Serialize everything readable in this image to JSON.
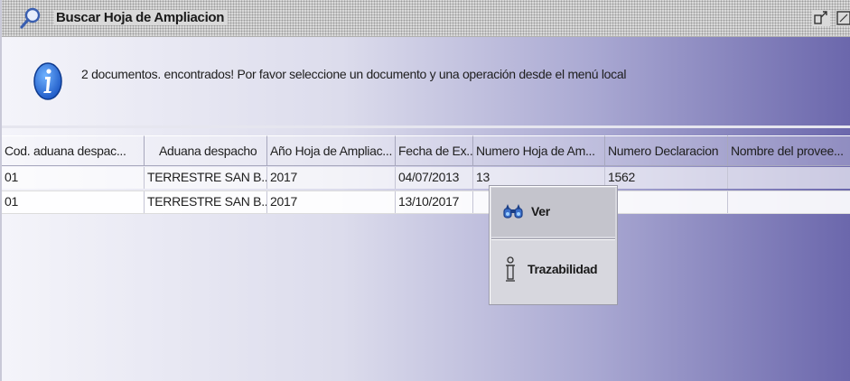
{
  "window": {
    "title": "Buscar Hoja de Ampliacion",
    "title_icon": "search-magnifier-icon",
    "controls": [
      "undock-icon",
      "maximize-icon"
    ]
  },
  "message": {
    "icon": "info-icon",
    "text": "2 documentos. encontrados! Por favor seleccione un documento y una operación desde el menú local"
  },
  "table": {
    "columns": [
      "Cod. aduana despac...",
      "Aduana despacho",
      "Año Hoja de Ampliac...",
      "Fecha de Ex...",
      "Numero Hoja de Am...",
      "Numero Declaracion",
      "Nombre del provee..."
    ],
    "rows": [
      [
        "01",
        "TERRESTRE SAN B...",
        "2017",
        "04/07/2013",
        "13",
        "1562",
        ""
      ],
      [
        "01",
        "TERRESTRE SAN B...",
        "2017",
        "13/10/2017",
        "",
        "",
        ""
      ]
    ]
  },
  "context_menu": {
    "items": [
      {
        "label": "Ver",
        "icon": "binoculars-icon"
      },
      {
        "label": "Trazabilidad",
        "icon": "trace-icon"
      }
    ]
  },
  "colors": {
    "background_light": "#f4f4fa",
    "background_dark": "#6b67ac",
    "titlebar": "#d9d9d9",
    "info_blue": "#1a6fd1",
    "menu_bg": "#d7d7de",
    "menu_highlight": "#c4c4cc"
  }
}
